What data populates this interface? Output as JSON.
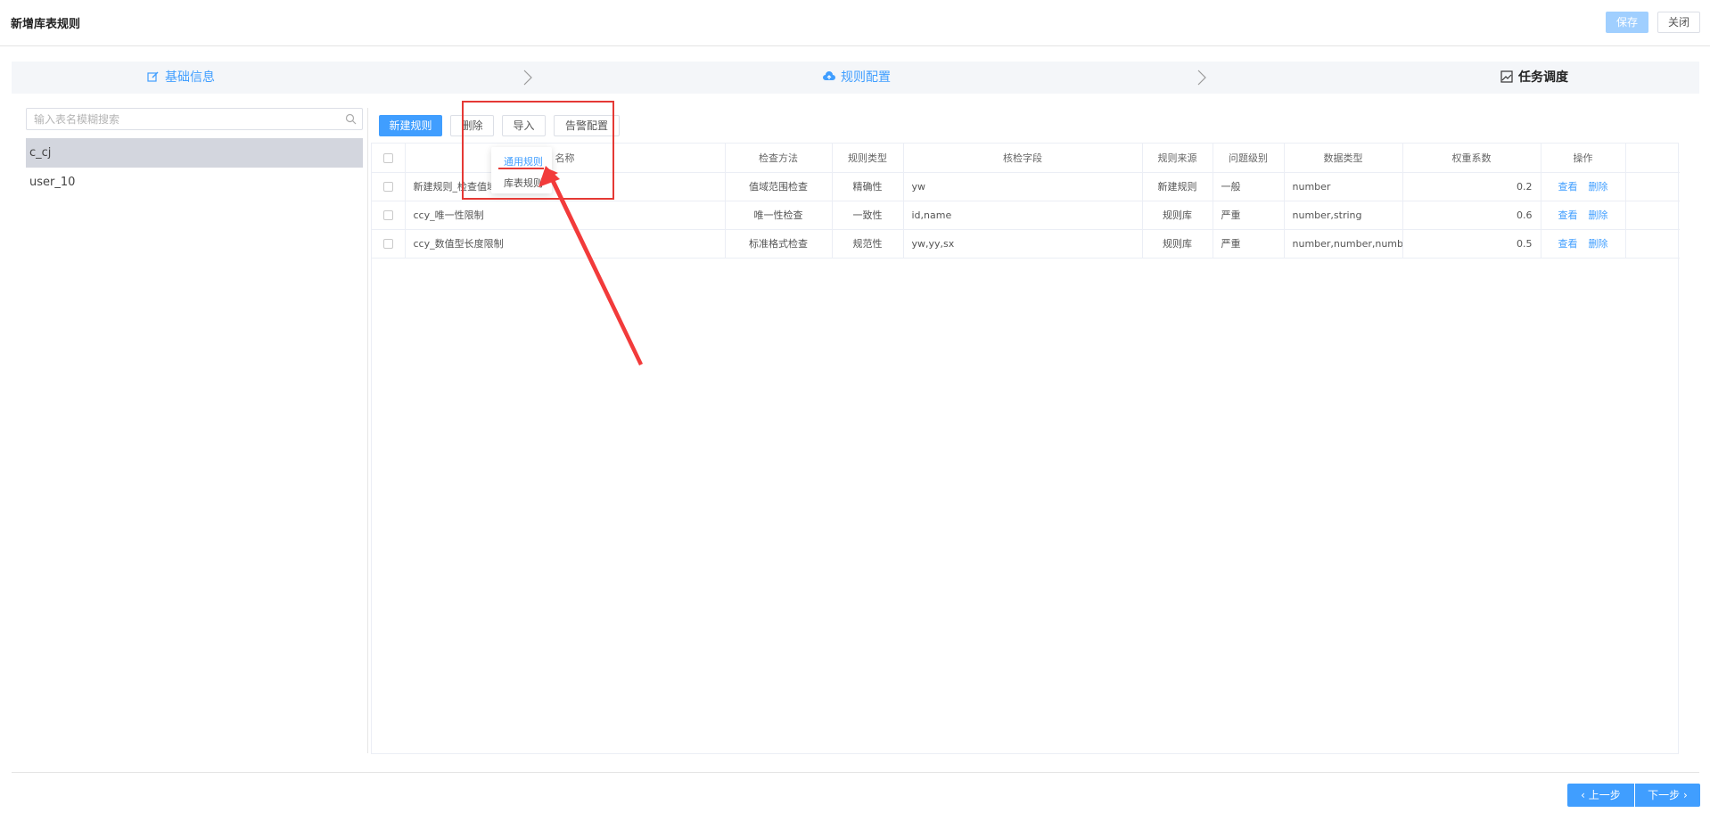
{
  "header": {
    "title": "新增库表规则",
    "save_label": "保存",
    "close_label": "关闭"
  },
  "steps": [
    {
      "label": "基础信息",
      "icon": "edit-icon"
    },
    {
      "label": "规则配置",
      "icon": "cloud-upload-icon"
    },
    {
      "label": "任务调度",
      "icon": "image-icon"
    }
  ],
  "sidebar": {
    "search_placeholder": "输入表名模糊搜索",
    "items": [
      {
        "label": "c_cj"
      },
      {
        "label": "user_10"
      }
    ]
  },
  "toolbar": {
    "new_label": "新建规则",
    "delete_label": "删除",
    "import_label": "导入",
    "alert_label": "告警配置"
  },
  "import_menu": {
    "items": [
      "通用规则",
      "库表规则"
    ]
  },
  "table": {
    "columns": [
      "名称",
      "检查方法",
      "规则类型",
      "核检字段",
      "规则来源",
      "问题级别",
      "数据类型",
      "权重系数",
      "操作"
    ],
    "rows": [
      {
        "name": "新建规则_检查值域",
        "method": "值域范围检查",
        "type": "精确性",
        "fields": "yw",
        "source": "新建规则",
        "level": "一般",
        "dtype": "number",
        "weight": "0.2"
      },
      {
        "name": "ccy_唯一性限制",
        "method": "唯一性检查",
        "type": "一致性",
        "fields": "id,name",
        "source": "规则库",
        "level": "严重",
        "dtype": "number,string",
        "weight": "0.6"
      },
      {
        "name": "ccy_数值型长度限制",
        "method": "标准格式检查",
        "type": "规范性",
        "fields": "yw,yy,sx",
        "source": "规则库",
        "level": "严重",
        "dtype": "number,number,number",
        "weight": "0.5"
      }
    ],
    "view_label": "查看",
    "delete_label": "删除"
  },
  "footer": {
    "prev_label": "上一步",
    "next_label": "下一步"
  },
  "colors": {
    "accent": "#409eff",
    "annotation": "#e53935"
  }
}
